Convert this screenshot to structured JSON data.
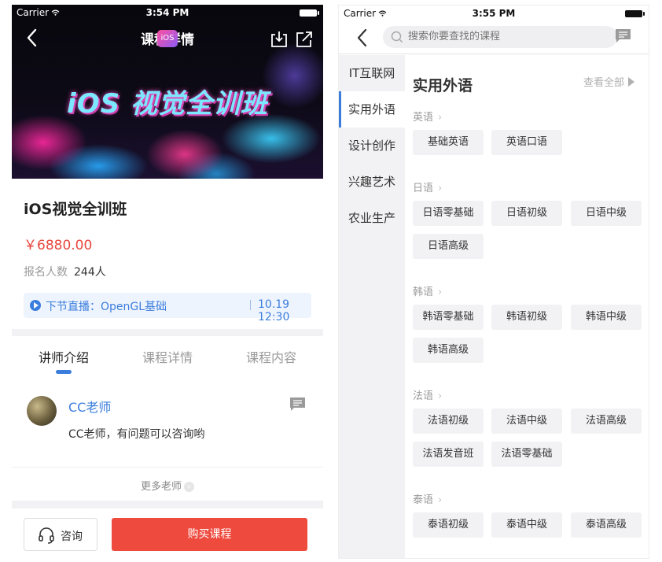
{
  "left": {
    "status": {
      "carrier": "Carrier",
      "time": "3:54 PM"
    },
    "nav": {
      "title": "课程详情",
      "badge": "iOS"
    },
    "banner_text": "iOS 视觉全训班",
    "course": {
      "title": "iOS视觉全训班",
      "price": "￥6880.00",
      "enroll_label": "报名人数",
      "enroll_count": "244人"
    },
    "live": {
      "text": "下节直播：OpenGL基础",
      "time": "10.19 12:30"
    },
    "tabs": [
      {
        "label": "讲师介绍",
        "active": true
      },
      {
        "label": "课程详情",
        "active": false
      },
      {
        "label": "课程内容",
        "active": false
      }
    ],
    "teacher": {
      "name": "CC老师",
      "description": "CC老师，有问题可以咨询哟"
    },
    "more_teachers": "更多老师",
    "bottom": {
      "consult": "咨询",
      "buy": "购买课程"
    },
    "colors": {
      "accent": "#3b7ddd",
      "price": "#e8473e",
      "buy": "#ef4a3e"
    }
  },
  "right": {
    "status": {
      "carrier": "Carrier",
      "time": "3:55 PM"
    },
    "search": {
      "placeholder": "搜索你要查找的课程"
    },
    "sidebar": [
      {
        "label": "IT互联网",
        "active": false
      },
      {
        "label": "实用外语",
        "active": true
      },
      {
        "label": "设计创作",
        "active": false
      },
      {
        "label": "兴趣艺术",
        "active": false
      },
      {
        "label": "农业生产",
        "active": false
      }
    ],
    "category_title": "实用外语",
    "view_all": "查看全部",
    "groups": [
      {
        "label": "英语",
        "items": [
          "基础英语",
          "英语口语"
        ]
      },
      {
        "label": "日语",
        "items": [
          "日语零基础",
          "日语初级",
          "日语中级",
          "日语高级"
        ]
      },
      {
        "label": "韩语",
        "items": [
          "韩语零基础",
          "韩语初级",
          "韩语中级",
          "韩语高级"
        ]
      },
      {
        "label": "法语",
        "items": [
          "法语初级",
          "法语中级",
          "法语高级",
          "法语发音班",
          "法语零基础"
        ]
      },
      {
        "label": "泰语",
        "items": [
          "泰语初级",
          "泰语中级",
          "泰语高级"
        ]
      }
    ]
  }
}
